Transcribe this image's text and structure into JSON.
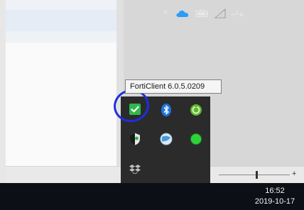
{
  "tooltip": {
    "text": "FortiClient 6.0.5.0209"
  },
  "tray_overflow": {
    "icons": [
      {
        "name": "forticlient-shield-check-icon",
        "color": "#2fb84a"
      },
      {
        "name": "bluetooth-icon",
        "color": "#1f74e0"
      },
      {
        "name": "green-sync-icon",
        "color": "#5db82c"
      },
      {
        "name": "security-shield-icon",
        "color": "#e9e9e9"
      },
      {
        "name": "network-globe-icon",
        "color": "#4a9ad8"
      },
      {
        "name": "green-status-icon",
        "color": "#2fd23a"
      },
      {
        "name": "dropbox-icon",
        "color": "#bfbfbf"
      }
    ]
  },
  "taskbar": {
    "show_hidden_icons_glyph": "^",
    "volume_glyph": "ᅴ×",
    "clock": {
      "time": "16:52",
      "date": "2019-10-17"
    }
  },
  "statusbar": {
    "zoom_plus": "+"
  },
  "colors": {
    "taskbar_bg": "#0c1016",
    "tray_bg": "#2b2b2b",
    "highlight_circle": "#1d2ee0",
    "onedrive_blue": "#2a9df4"
  }
}
